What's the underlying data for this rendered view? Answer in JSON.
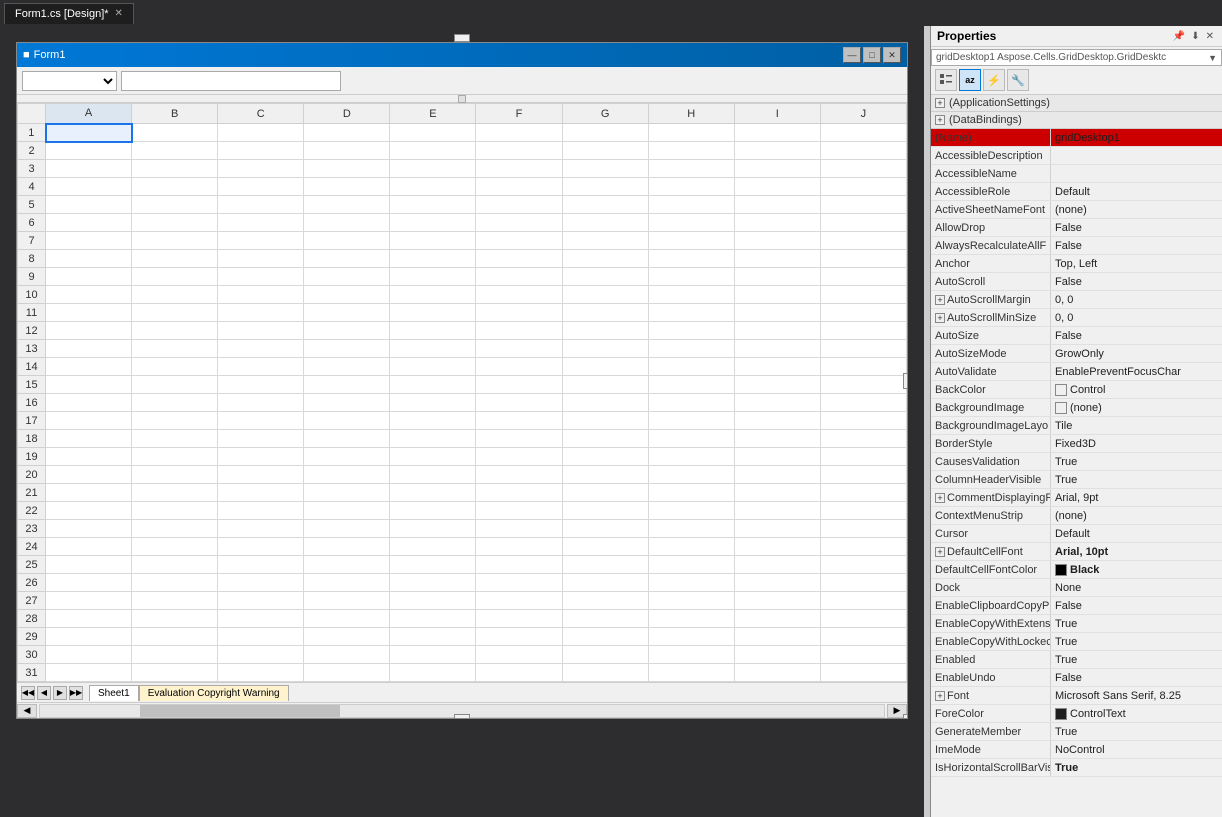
{
  "tabBar": {
    "tabs": [
      {
        "label": "Form1.cs [Design]*",
        "active": true
      }
    ]
  },
  "formWindow": {
    "title": "Form1",
    "icon": "■",
    "buttons": [
      "—",
      "□",
      "✕"
    ]
  },
  "toolbar": {
    "dropdownValue": "",
    "inputValue": ""
  },
  "spreadsheet": {
    "columns": [
      "A",
      "B",
      "C",
      "D",
      "E",
      "F",
      "G",
      "H",
      "I",
      "J"
    ],
    "rows": [
      1,
      2,
      3,
      4,
      5,
      6,
      7,
      8,
      9,
      10,
      11,
      12,
      13,
      14,
      15,
      16,
      17,
      18,
      19,
      20,
      21,
      22,
      23,
      24,
      25,
      26,
      27,
      28,
      29,
      30,
      31
    ]
  },
  "sheetTabs": [
    {
      "label": "Sheet1",
      "active": true
    },
    {
      "label": "Evaluation Copyright Warning",
      "warning": true
    }
  ],
  "propertiesPanel": {
    "title": "Properties",
    "objectName": "gridDesktop1",
    "objectType": "Aspose.Cells.GridDesktop.GridDesktc",
    "toolbarButtons": [
      {
        "label": "⊞",
        "title": "categorized",
        "active": false
      },
      {
        "label": "az",
        "title": "alphabetical",
        "active": true
      },
      {
        "label": "⚡",
        "title": "events",
        "active": false
      },
      {
        "label": "🔧",
        "title": "property-pages",
        "active": false
      }
    ],
    "groups": [
      {
        "label": "(ApplicationSettings)",
        "expanded": true,
        "rows": []
      },
      {
        "label": "(DataBindings)",
        "expanded": true,
        "rows": []
      }
    ],
    "properties": [
      {
        "name": "(Name)",
        "value": "gridDesktop1",
        "highlighted": true,
        "colorSwatch": null
      },
      {
        "name": "AccessibleDescription",
        "value": "",
        "highlighted": false
      },
      {
        "name": "AccessibleName",
        "value": "",
        "highlighted": false
      },
      {
        "name": "AccessibleRole",
        "value": "Default",
        "highlighted": false
      },
      {
        "name": "ActiveSheetNameFont",
        "value": "(none)",
        "highlighted": false
      },
      {
        "name": "AllowDrop",
        "value": "False",
        "highlighted": false
      },
      {
        "name": "AlwaysRecalculateAllF",
        "value": "False",
        "highlighted": false
      },
      {
        "name": "Anchor",
        "value": "Top, Left",
        "highlighted": false
      },
      {
        "name": "AutoScroll",
        "value": "False",
        "highlighted": false
      },
      {
        "name": "AutoScrollMargin",
        "value": "0, 0",
        "highlighted": false,
        "expandable": true
      },
      {
        "name": "AutoScrollMinSize",
        "value": "0, 0",
        "highlighted": false,
        "expandable": true
      },
      {
        "name": "AutoSize",
        "value": "False",
        "highlighted": false
      },
      {
        "name": "AutoSizeMode",
        "value": "GrowOnly",
        "highlighted": false
      },
      {
        "name": "AutoValidate",
        "value": "EnablePreventFocusChar",
        "highlighted": false
      },
      {
        "name": "BackColor",
        "value": "Control",
        "highlighted": false,
        "colorSwatch": "#f0f0f0"
      },
      {
        "name": "BackgroundImage",
        "value": "(none)",
        "highlighted": false,
        "colorSwatch": "#f0f0f0"
      },
      {
        "name": "BackgroundImageLayo",
        "value": "Tile",
        "highlighted": false
      },
      {
        "name": "BorderStyle",
        "value": "Fixed3D",
        "highlighted": false
      },
      {
        "name": "CausesValidation",
        "value": "True",
        "highlighted": false
      },
      {
        "name": "ColumnHeaderVisible",
        "value": "True",
        "highlighted": false
      },
      {
        "name": "CommentDisplayingFo",
        "value": "Arial, 9pt",
        "highlighted": false,
        "expandable": true
      },
      {
        "name": "ContextMenuStrip",
        "value": "(none)",
        "highlighted": false
      },
      {
        "name": "Cursor",
        "value": "Default",
        "highlighted": false
      },
      {
        "name": "DefaultCellFont",
        "value": "Arial, 10pt",
        "highlighted": false,
        "expandable": true,
        "bold": true
      },
      {
        "name": "DefaultCellFontColor",
        "value": "Black",
        "highlighted": false,
        "colorSwatch": "#000000",
        "bold": true
      },
      {
        "name": "Dock",
        "value": "None",
        "highlighted": false
      },
      {
        "name": "EnableClipboardCopyP",
        "value": "False",
        "highlighted": false
      },
      {
        "name": "EnableCopyWithExtensi",
        "value": "True",
        "highlighted": false
      },
      {
        "name": "EnableCopyWithLockec",
        "value": "True",
        "highlighted": false
      },
      {
        "name": "Enabled",
        "value": "True",
        "highlighted": false
      },
      {
        "name": "EnableUndo",
        "value": "False",
        "highlighted": false
      },
      {
        "name": "Font",
        "value": "Microsoft Sans Serif, 8.25",
        "highlighted": false,
        "expandable": true
      },
      {
        "name": "ForeColor",
        "value": "ControlText",
        "highlighted": false,
        "colorSwatch": "#1e1e1e"
      },
      {
        "name": "GenerateMember",
        "value": "True",
        "highlighted": false
      },
      {
        "name": "ImeMode",
        "value": "NoControl",
        "highlighted": false
      },
      {
        "name": "IsHorizontalScrollBarVis",
        "value": "True",
        "highlighted": false,
        "bold": true
      }
    ]
  }
}
